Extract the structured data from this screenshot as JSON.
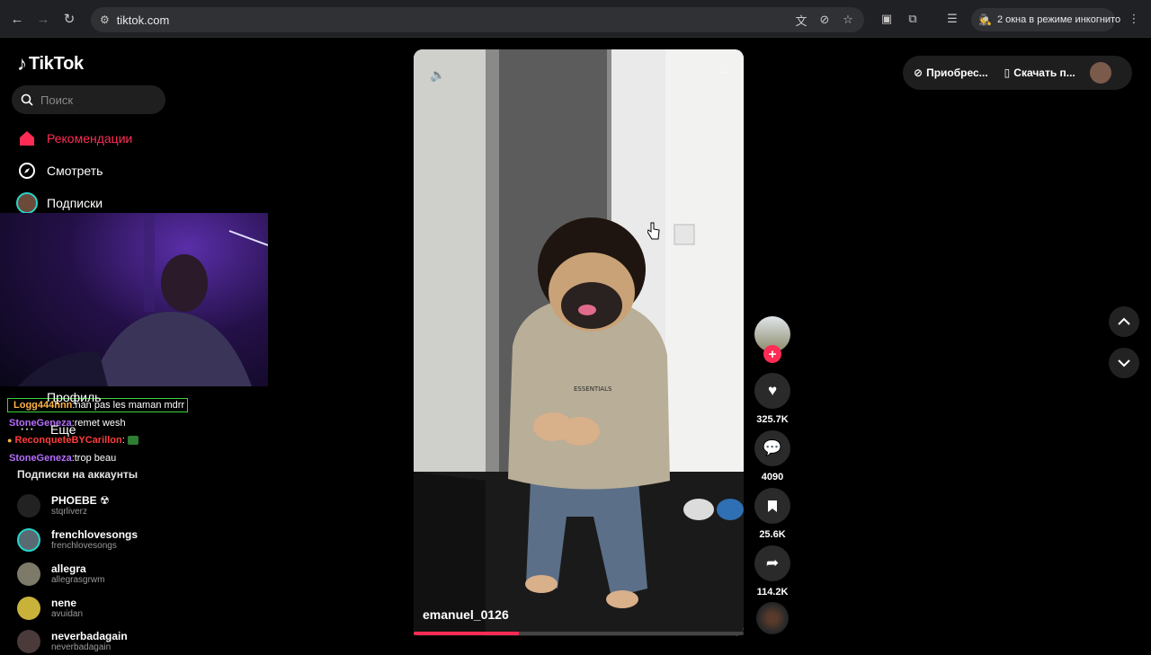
{
  "browser": {
    "url": "tiktok.com",
    "incognito_label": "2 окна в режиме инкогнито"
  },
  "app": {
    "brand": "TikTok"
  },
  "sidebar": {
    "search_placeholder": "Поиск",
    "nav": [
      {
        "label": "Рекомендации",
        "icon": "home-icon",
        "active": true
      },
      {
        "label": "Смотреть",
        "icon": "compass-icon"
      },
      {
        "label": "Подписки",
        "icon": "following-avatar-icon"
      },
      {
        "label": "Профиль",
        "icon": "profile-icon"
      },
      {
        "label": "Еще",
        "icon": "more-icon"
      }
    ],
    "following_title": "Подписки на аккаунты",
    "following": [
      {
        "name": "PHOEBE ☢",
        "handle": "stqrliverz"
      },
      {
        "name": "frenchlovesongs",
        "handle": "frenchlovesongs"
      },
      {
        "name": "allegra",
        "handle": "allegrasgrwm"
      },
      {
        "name": "nene",
        "handle": "avuidan"
      },
      {
        "name": "neverbadagain",
        "handle": "neverbadagain"
      }
    ]
  },
  "overlay_chat": [
    {
      "user": "Logg444hnn",
      "text": ":nan pas les maman mdrr"
    },
    {
      "user": "StoneGeneza",
      "text": ":remet wesh"
    },
    {
      "user": "ReconqueteBYCarillon",
      "text": ":"
    },
    {
      "user": "StoneGeneza",
      "text": ":trop beau"
    }
  ],
  "video": {
    "author": "emanuel_0126",
    "progress": 0.32,
    "actions": {
      "likes": "325.7K",
      "comments": "4090",
      "saves": "25.6K",
      "shares": "114.2K"
    }
  },
  "header_actions": {
    "buy": "Приобрес...",
    "download": "Скачать п..."
  },
  "colors": {
    "accent": "#fe2c55",
    "background": "#000000",
    "chrome": "#202124"
  }
}
